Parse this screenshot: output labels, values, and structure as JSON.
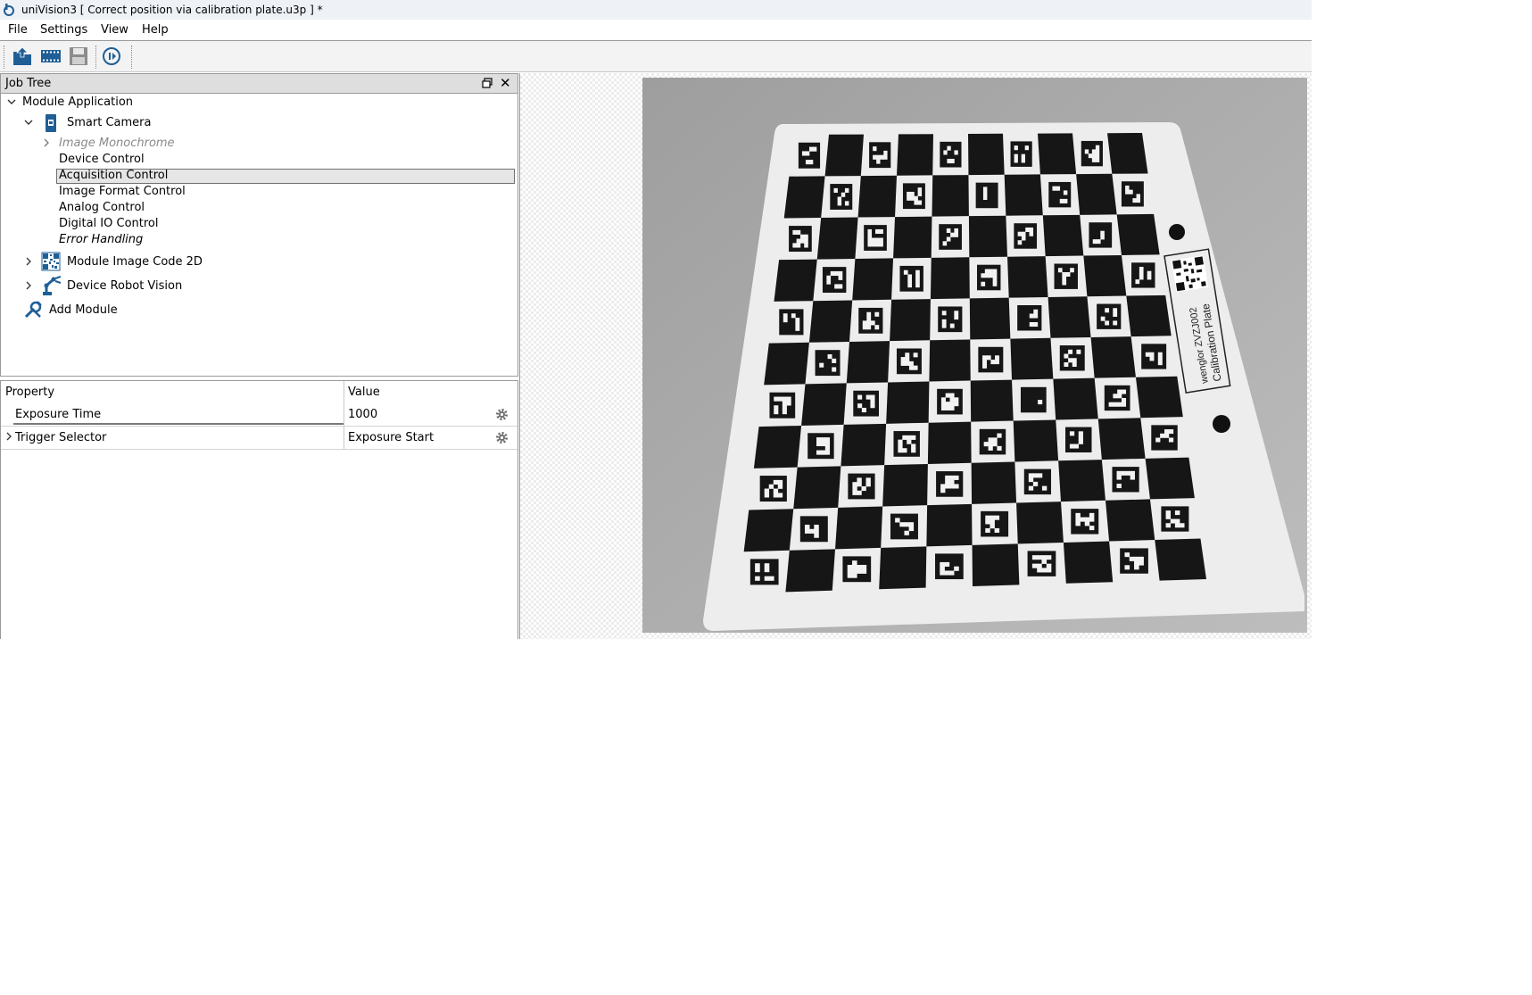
{
  "window": {
    "title": "uniVision3 [ Correct position via calibration plate.u3p ] *"
  },
  "menu": [
    "File",
    "Settings",
    "View",
    "Help"
  ],
  "toolbar": {
    "buttons": [
      "open-project-icon",
      "film-icon",
      "save-icon",
      "run-icon"
    ]
  },
  "job_tree": {
    "title": "Job Tree",
    "nodes": {
      "module_application": "Module Application",
      "smart_camera": "Smart Camera",
      "image_monochrome": "Image Monochrome",
      "device_control": "Device Control",
      "acquisition_control": "Acquisition Control",
      "image_format_control": "Image Format Control",
      "analog_control": "Analog Control",
      "digital_io_control": "Digital IO Control",
      "error_handling": "Error Handling",
      "module_image_code": "Module Image Code 2D",
      "device_robot_vision": "Device Robot Vision",
      "add_module": "Add Module"
    }
  },
  "properties": {
    "header": {
      "property": "Property",
      "value": "Value"
    },
    "rows": [
      {
        "name": "Exposure Time",
        "value": "1000"
      },
      {
        "name": "Trigger Selector",
        "value": "Exposure Start"
      }
    ]
  },
  "image": {
    "plate_label_1": "wenglor ZVZJ002",
    "plate_label_2": "Calibration Plate"
  },
  "colors": {
    "accent": "#1f5f96",
    "selection": "#e6e6e6"
  }
}
